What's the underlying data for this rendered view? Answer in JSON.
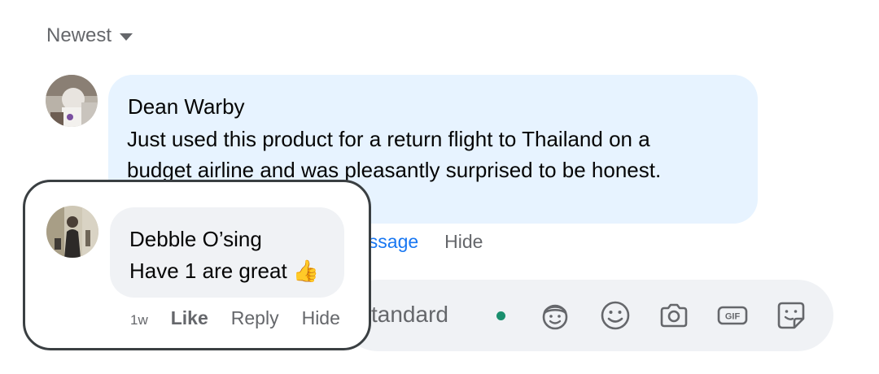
{
  "sort": {
    "label": "Newest"
  },
  "main_comment": {
    "author": "Dean Warby",
    "text_line1": "Just used this product for a return flight to Thailand on a",
    "text_line2": "budget airline and was pleasantly surprised to be honest.",
    "actions": {
      "message_partial": "essage",
      "hide": "Hide"
    }
  },
  "composer": {
    "placeholder_partial": "tandard",
    "icons": [
      "avatar-sticker-icon",
      "emoji-icon",
      "camera-icon",
      "gif-icon",
      "sticker-icon"
    ],
    "gif_label": "GIF"
  },
  "reply": {
    "author": "Debble O’sing",
    "text": "Have 1 are great",
    "emoji": "👍",
    "time": "1w",
    "like": "Like",
    "reply": "Reply",
    "hide": "Hide"
  },
  "colors": {
    "main_bubble": "#e7f3ff",
    "reply_bubble": "#f0f2f5",
    "link_blue": "#1877f2",
    "secondary_text": "#65676b",
    "presence_dot": "#1a8f6e",
    "card_border": "#3a3f42"
  }
}
